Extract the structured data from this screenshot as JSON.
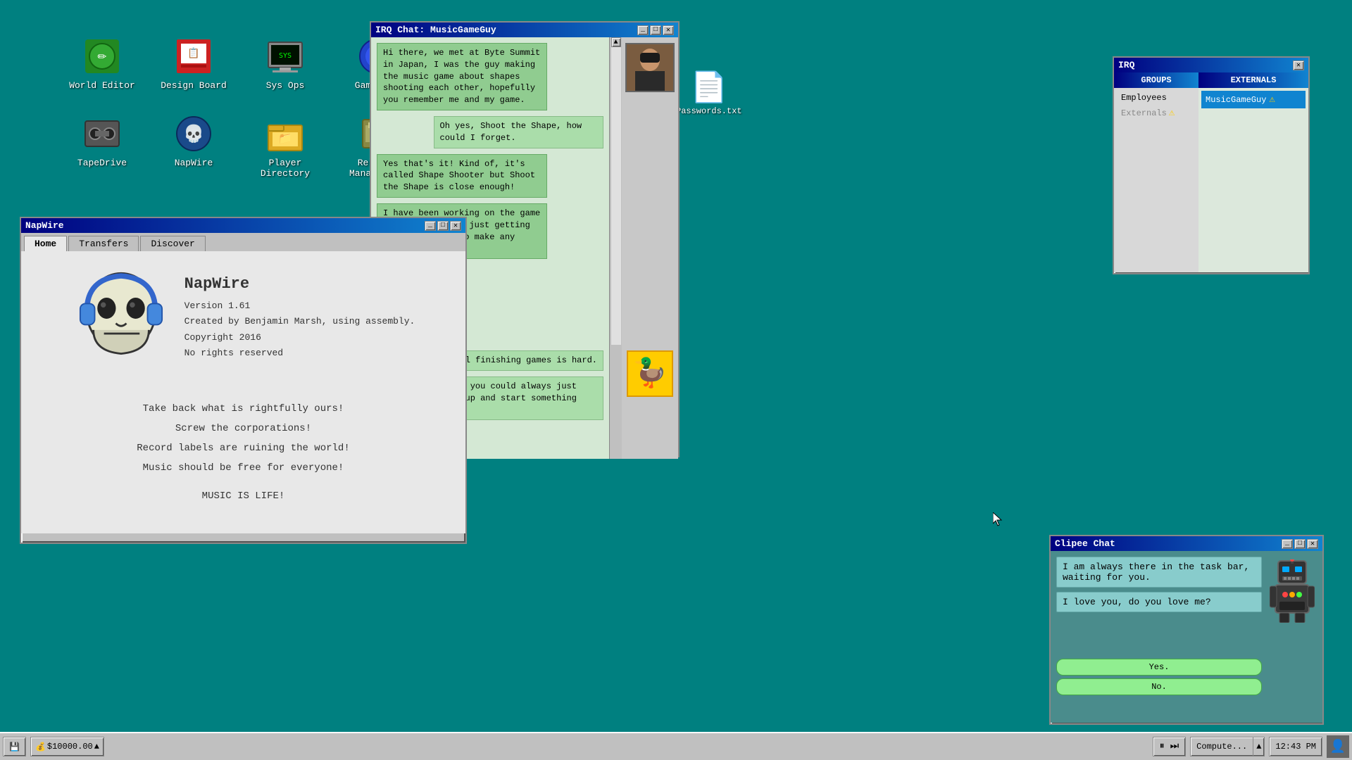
{
  "desktop": {
    "icons_row1": [
      {
        "id": "world-editor",
        "label": "World Editor",
        "emoji": "✏️"
      },
      {
        "id": "design-board",
        "label": "Design Board",
        "emoji": "📋"
      },
      {
        "id": "sys-ops",
        "label": "Sys Ops",
        "emoji": "🖥️"
      },
      {
        "id": "gamelink",
        "label": "GameLink",
        "emoji": "🎮"
      }
    ],
    "icons_row2": [
      {
        "id": "tapedrive",
        "label": "TapeDrive",
        "emoji": "📼"
      },
      {
        "id": "napwire",
        "label": "NapWire",
        "emoji": "💀"
      },
      {
        "id": "player-directory",
        "label": "Player Directory",
        "emoji": "📁"
      },
      {
        "id": "release-management",
        "label": "Release Management",
        "emoji": "📦"
      }
    ]
  },
  "passwords_icon": {
    "label": "Passwords.txt",
    "emoji": "📄"
  },
  "irq_chat": {
    "title": "IRQ Chat: MusicGameGuy",
    "messages": [
      {
        "side": "left",
        "text": "Hi there, we met at Byte Summit in Japan, I was the guy making the music game about shapes shooting each other, hopefully you remember me and my game."
      },
      {
        "side": "right",
        "text": "Oh yes, Shoot the Shape, how could I forget."
      },
      {
        "side": "left",
        "text": "Yes that's it! Kind of, it's called Shape Shooter but Shoot the Shape is close enough!"
      },
      {
        "side": "left",
        "text": "I have been working on the game for months, it's just getting very difficult to make any progress."
      },
      {
        "side": "right",
        "text": "Well finishing games is hard."
      },
      {
        "side": "right",
        "text": "Well, you could always just give up and start something new."
      }
    ]
  },
  "napwire": {
    "title": "NapWire",
    "tabs": [
      "Home",
      "Transfers",
      "Discover"
    ],
    "active_tab": "Home",
    "app_title": "NapWire",
    "version": "Version 1.61",
    "created_by": "Created by Benjamin Marsh, using assembly.",
    "copyright": "Copyright 2016",
    "rights": "No rights reserved",
    "motd_lines": [
      "Take back what is rightfully ours!",
      "Screw the corporations!",
      "Record labels are ruining the world!",
      "Music should be free for everyone!",
      "",
      "MUSIC IS LIFE!"
    ]
  },
  "irq_panel": {
    "title": "IRQ",
    "header_groups": "GROUPS",
    "header_externals": "EXTERNALS",
    "groups_items": [
      "Employees",
      "Externals ⚠"
    ],
    "externals_items": [
      "MusicGameGuy ⚠"
    ],
    "employees_label": "Employees",
    "externals_label": "Externals",
    "musicgameguy_label": "MusicGameGuy"
  },
  "clipee": {
    "title": "Clipee Chat",
    "messages": [
      "I am always there in the task bar, waiting for you.",
      "I love you, do you love me?"
    ],
    "buttons": [
      "Yes.",
      "No."
    ]
  },
  "taskbar": {
    "money_icon": "💰",
    "money_amount": "$10000.00",
    "money_arrow": "▲",
    "media_pause": "⏸",
    "media_skip": "⏭",
    "compute_label": "Compute...",
    "compute_arrow": "▲",
    "clock": "12:43 PM",
    "user_icon": "👤",
    "hdd_icon": "💾"
  }
}
